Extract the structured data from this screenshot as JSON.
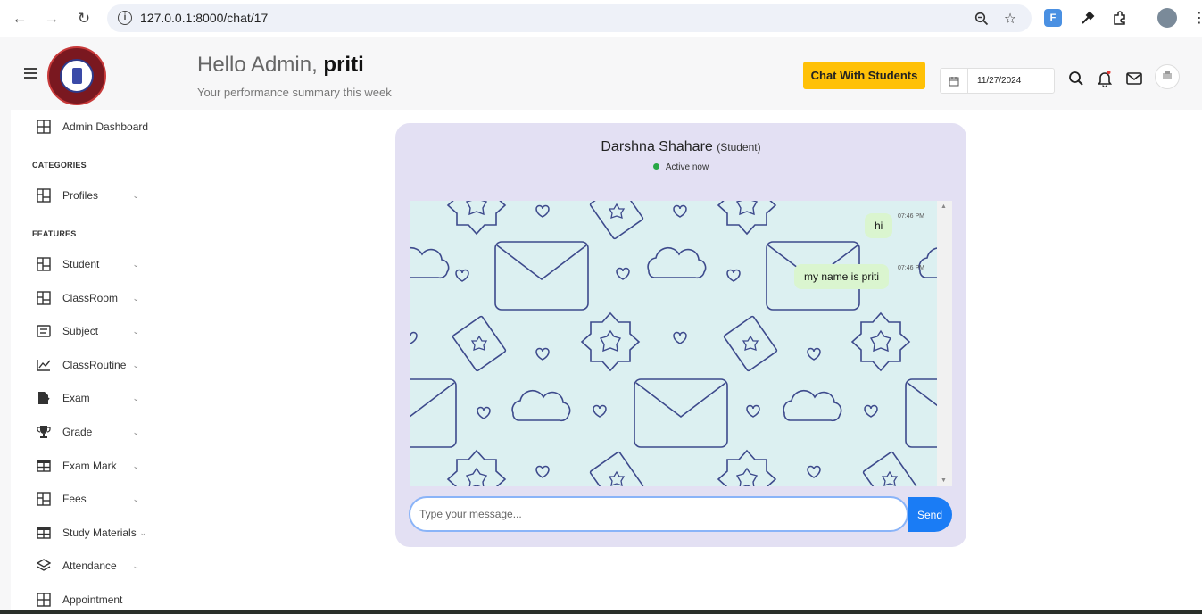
{
  "browser": {
    "url": "127.0.0.1:8000/chat/17"
  },
  "header": {
    "greeting_prefix": "Hello Admin, ",
    "greeting_name": "priti",
    "subtitle": "Your performance summary this week",
    "chat_button": "Chat With Students",
    "date": "11/27/2024"
  },
  "sidebar": {
    "dashboard": "Admin Dashboard",
    "categories_heading": "CATEGORIES",
    "features_heading": "FEATURES",
    "items": [
      {
        "label": "Profiles",
        "icon": "grid-icon"
      },
      {
        "label": "Student",
        "icon": "grid-icon"
      },
      {
        "label": "ClassRoom",
        "icon": "grid-icon"
      },
      {
        "label": "Subject",
        "icon": "list-icon"
      },
      {
        "label": "ClassRoutine",
        "icon": "chart-line-icon"
      },
      {
        "label": "Exam",
        "icon": "file-check-icon"
      },
      {
        "label": "Grade",
        "icon": "trophy-icon"
      },
      {
        "label": "Exam Mark",
        "icon": "table-icon"
      },
      {
        "label": "Fees",
        "icon": "grid-icon"
      },
      {
        "label": "Study Materials",
        "icon": "table-icon"
      },
      {
        "label": "Attendance",
        "icon": "layers-icon"
      },
      {
        "label": "Appointment",
        "icon": "grid-icon"
      }
    ]
  },
  "chat": {
    "name": "Darshna Shahare",
    "role": "(Student)",
    "status": "Active now",
    "messages": [
      {
        "text": "hi",
        "time": "07:46 PM"
      },
      {
        "text": "my name is priti",
        "time": "07:46 PM"
      }
    ],
    "input_placeholder": "Type your message...",
    "send_label": "Send"
  }
}
